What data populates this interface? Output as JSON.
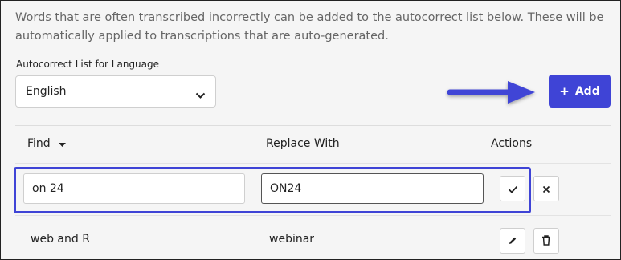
{
  "description": "Words that are often transcribed incorrectly can be added to the autocorrect list below. These will be automatically applied to transcriptions that are auto-generated.",
  "language_select": {
    "label": "Autocorrect List for Language",
    "value": "English"
  },
  "add_button": {
    "label": "Add",
    "icon": "plus-icon"
  },
  "table": {
    "columns": {
      "find": "Find",
      "replace": "Replace With",
      "actions": "Actions"
    },
    "sort_icon": "caret-down-icon",
    "edit_row": {
      "find_value": "on 24",
      "replace_value": "ON24",
      "confirm_icon": "check-icon",
      "cancel_icon": "close-icon"
    },
    "rows": [
      {
        "find": "web and R",
        "replace": "webinar",
        "edit_icon": "pencil-icon",
        "delete_icon": "trash-icon"
      }
    ]
  },
  "colors": {
    "accent": "#3f44d6",
    "annotation": "#3f44d6"
  }
}
